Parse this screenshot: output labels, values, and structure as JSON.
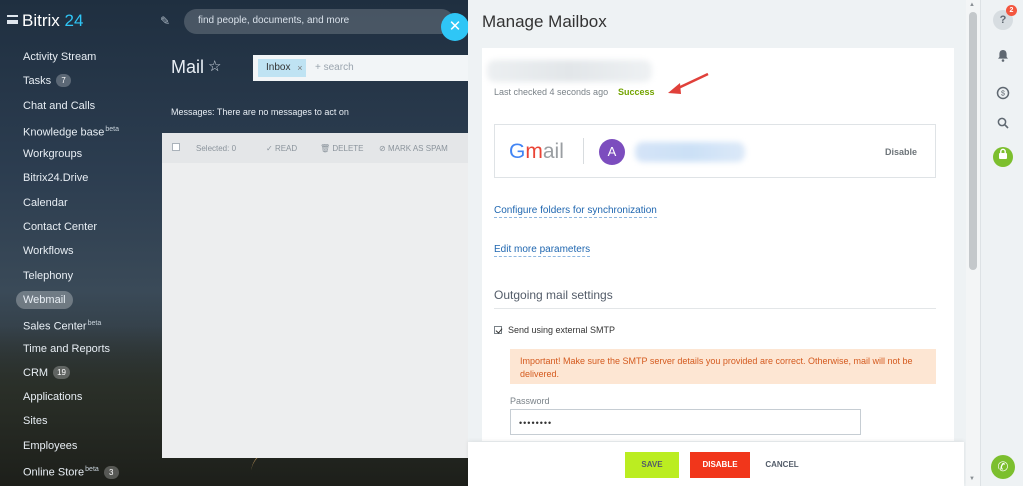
{
  "app": {
    "brand_name": "Bitrix",
    "brand_number": "24",
    "global_search_placeholder": "find people, documents, and more"
  },
  "sidebar": {
    "items": [
      {
        "label": "Activity Stream",
        "sup": "",
        "counter": ""
      },
      {
        "label": "Tasks",
        "sup": "",
        "counter": "7"
      },
      {
        "label": "Chat and Calls",
        "sup": "",
        "counter": ""
      },
      {
        "label": "Knowledge base",
        "sup": "beta",
        "counter": ""
      },
      {
        "label": "Workgroups",
        "sup": "",
        "counter": ""
      },
      {
        "label": "Bitrix24.Drive",
        "sup": "",
        "counter": ""
      },
      {
        "label": "Calendar",
        "sup": "",
        "counter": ""
      },
      {
        "label": "Contact Center",
        "sup": "",
        "counter": ""
      },
      {
        "label": "Workflows",
        "sup": "",
        "counter": ""
      },
      {
        "label": "Telephony",
        "sup": "",
        "counter": ""
      },
      {
        "label": "Webmail",
        "sup": "",
        "counter": ""
      },
      {
        "label": "Sales Center",
        "sup": "beta",
        "counter": ""
      },
      {
        "label": "Time and Reports",
        "sup": "",
        "counter": ""
      },
      {
        "label": "CRM",
        "sup": "",
        "counter": "19"
      },
      {
        "label": "Applications",
        "sup": "",
        "counter": ""
      },
      {
        "label": "Sites",
        "sup": "",
        "counter": ""
      },
      {
        "label": "Employees",
        "sup": "",
        "counter": ""
      },
      {
        "label": "Online Store",
        "sup": "beta",
        "counter": "3"
      }
    ],
    "active_index": 10
  },
  "mail": {
    "title": "Mail",
    "filter_tag": "Inbox",
    "filter_placeholder": "+ search",
    "note": "Messages: There are no messages to act on",
    "toolbar": {
      "selected": "Selected: 0",
      "read": "READ",
      "delete": "DELETE",
      "spam": "MARK AS SPAM"
    }
  },
  "slider": {
    "title": "Manage Mailbox",
    "last_checked": "Last checked 4 seconds ago",
    "status": "Success",
    "account": {
      "provider": "Gmail",
      "avatar_letter": "A",
      "disable_label": "Disable"
    },
    "links": {
      "configure_folders": "Configure folders for synchronization",
      "edit_params": "Edit more parameters"
    },
    "outgoing": {
      "title": "Outgoing mail settings",
      "smtp_checkbox_label": "Send using external SMTP",
      "smtp_checked": true,
      "warning": "Important! Make sure the SMTP server details you provided are correct. Otherwise, mail will not be delivered.",
      "password_label": "Password",
      "password_value": "••••••••"
    },
    "footer": {
      "save": "SAVE",
      "disable": "DISABLE",
      "cancel": "CANCEL"
    }
  },
  "rail": {
    "help_badge": "2"
  },
  "colors": {
    "accent": "#2fc6f6",
    "success": "#73a400",
    "save_btn": "#bbed21",
    "disable_btn": "#f1361b",
    "warning_bg": "#fde6d3",
    "warning_text": "#d45a1e",
    "link": "#2067b0"
  },
  "icons": [
    "menu-icon",
    "pencil-icon",
    "star-icon",
    "close-icon",
    "help-icon",
    "bell-icon",
    "chat-icon",
    "search-icon",
    "lock-icon",
    "phone-icon"
  ]
}
